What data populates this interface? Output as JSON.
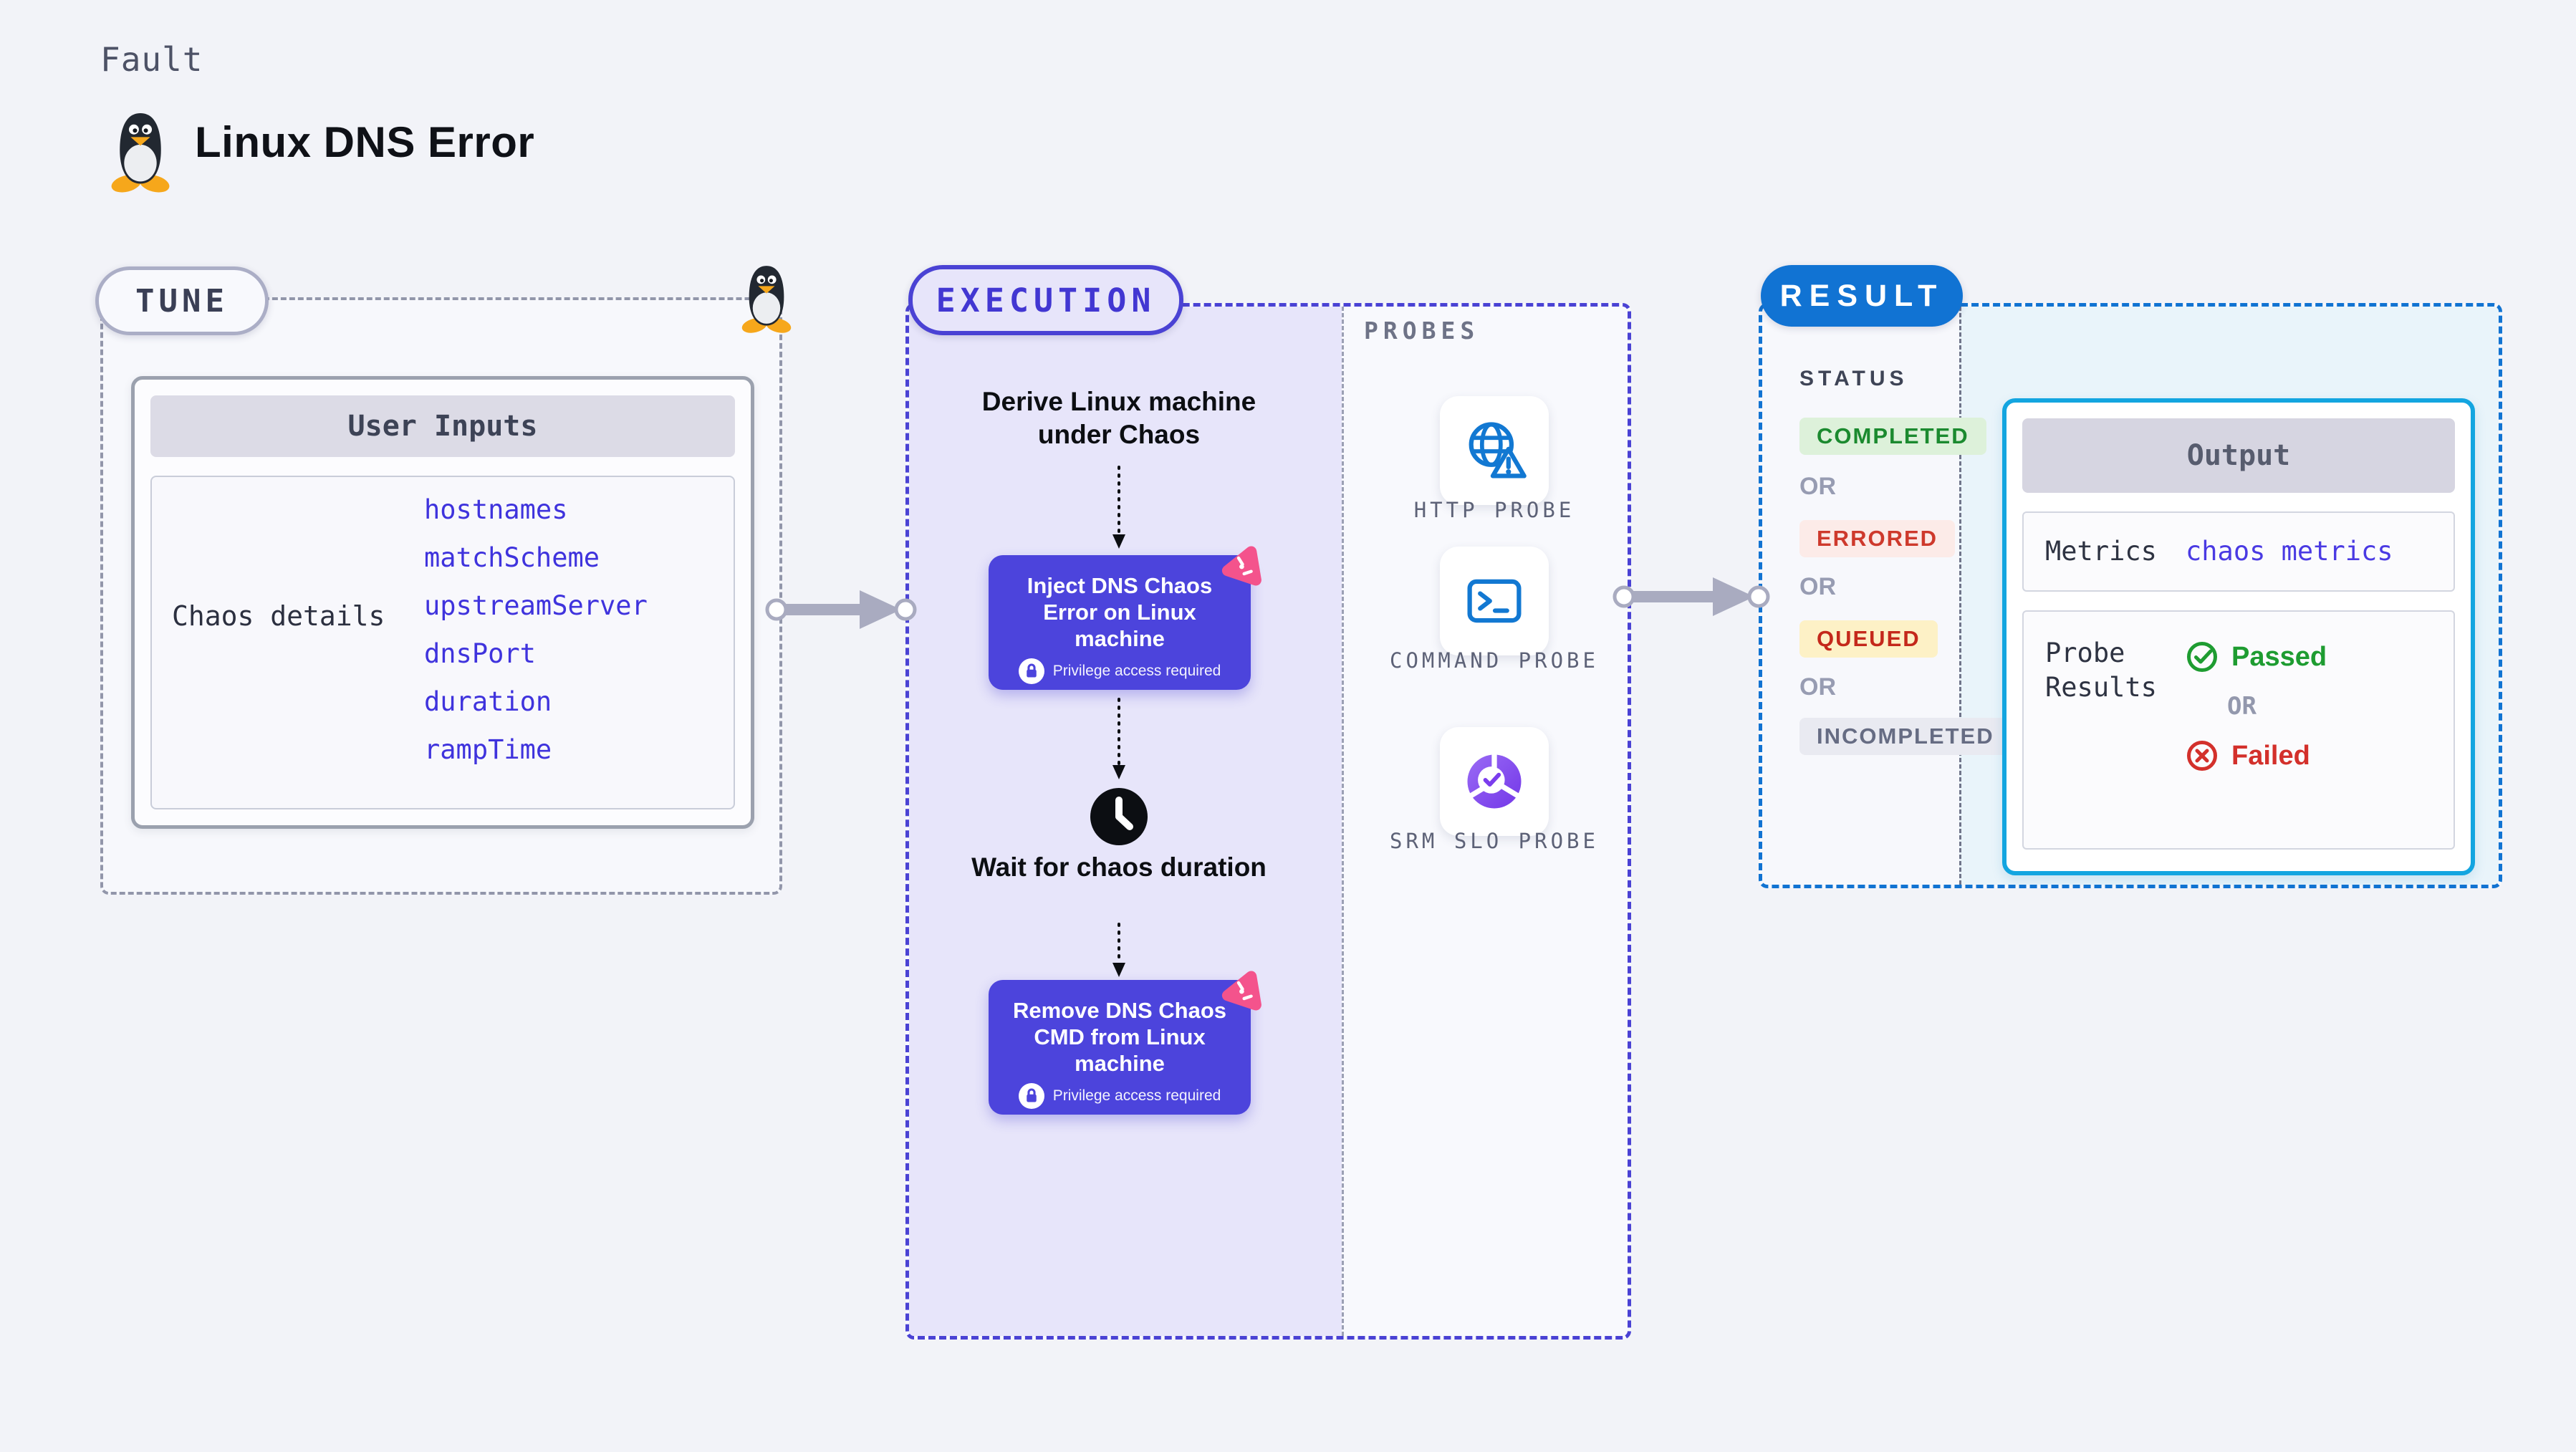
{
  "page": {
    "kind_label": "Fault",
    "title": "Linux DNS Error"
  },
  "tune": {
    "badge": "TUNE",
    "table_title": "User Inputs",
    "row_label": "Chaos details",
    "params": [
      "hostnames",
      "matchScheme",
      "upstreamServer",
      "dnsPort",
      "duration",
      "rampTime"
    ]
  },
  "execution": {
    "badge": "EXECUTION",
    "step_derive": "Derive Linux machine under Chaos",
    "inject": {
      "label": "Inject DNS Chaos Error on Linux machine",
      "note": "Privilege access required"
    },
    "step_wait": "Wait for chaos duration",
    "remove": {
      "label": "Remove DNS Chaos CMD from Linux machine",
      "note": "Privilege access required"
    }
  },
  "probes": {
    "label": "PROBES",
    "items": [
      {
        "name": "HTTP PROBE",
        "icon": "globe-alert-icon"
      },
      {
        "name": "COMMAND PROBE",
        "icon": "terminal-icon"
      },
      {
        "name": "SRM SLO PROBE",
        "icon": "slo-donut-check-icon"
      }
    ]
  },
  "result": {
    "badge": "RESULT",
    "status_label": "STATUS",
    "or_label": "OR",
    "statuses": [
      "COMPLETED",
      "ERRORED",
      "QUEUED",
      "INCOMPLETED"
    ],
    "output": {
      "title": "Output",
      "metrics_label": "Metrics",
      "metrics_value": "chaos metrics",
      "probe_results_label": "Probe Results",
      "passed": "Passed",
      "or": "OR",
      "failed": "Failed"
    }
  },
  "colors": {
    "page_bg": "#f2f3f8",
    "execution_accent": "#4a42d4",
    "execution_fill": "#e7e5fa",
    "step_button": "#4c44dc",
    "result_accent": "#1173d3",
    "result_fill": "#e9f4fa",
    "output_border": "#13a5e0",
    "param_text": "#3f33dd",
    "status_completed": "#1b8a2f",
    "status_errored": "#ce392c",
    "status_queued": "#c4281b",
    "status_incompleted": "#666c83",
    "passed_green": "#1e9c31",
    "failed_red": "#d3302b",
    "chaos_badge_pink": "#f4538c",
    "probe_icon_blue": "#1278d2"
  }
}
